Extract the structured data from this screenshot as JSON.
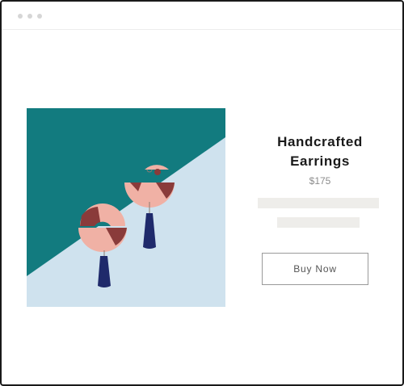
{
  "product": {
    "title": "Handcrafted Earrings",
    "price": "$175",
    "image": "handcrafted-earrings-photo",
    "buy_label": "Buy Now"
  },
  "colors": {
    "teal_background": "#127b7f",
    "light_blue_background": "#cfe2ee",
    "earring_pink": "#f0b1a5",
    "earring_maroon": "#8a3b3a",
    "earring_navy": "#1f2a6b",
    "button_border": "#9a9a9a",
    "placeholder": "#eeedea"
  }
}
